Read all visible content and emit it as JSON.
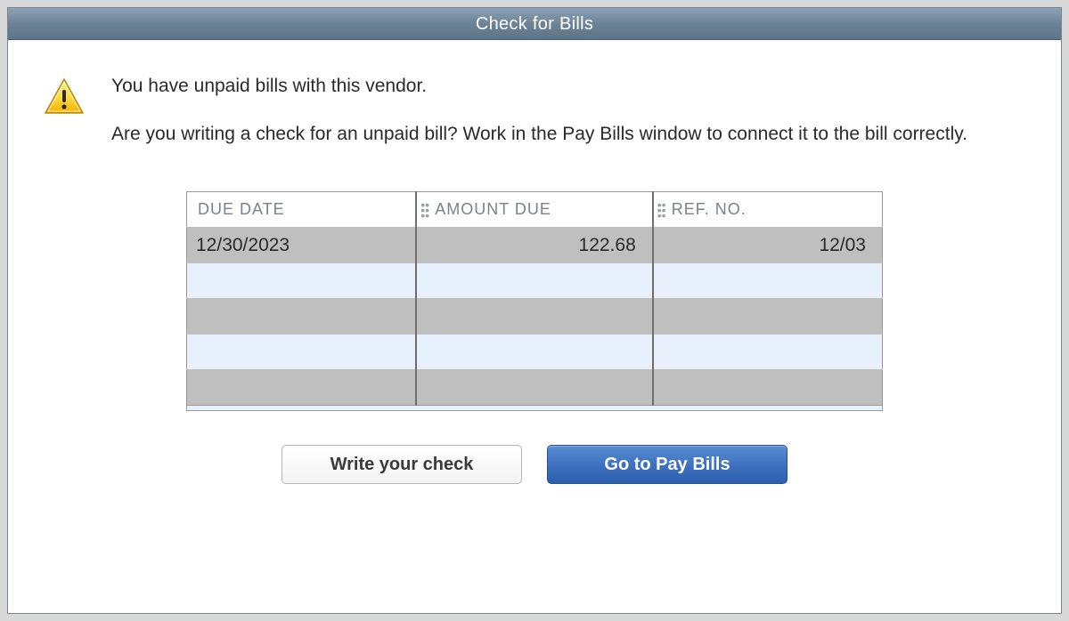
{
  "window": {
    "title": "Check for Bills"
  },
  "message": {
    "line1": "You have unpaid bills with this vendor.",
    "line2": "Are you writing a check for an unpaid bill? Work in the Pay Bills window to connect it to the bill correctly."
  },
  "table": {
    "headers": {
      "due_date": "DUE DATE",
      "amount_due": "AMOUNT DUE",
      "ref_no": "REF. NO."
    },
    "rows": [
      {
        "due_date": "12/30/2023",
        "amount_due": "122.68",
        "ref_no": "12/03"
      }
    ]
  },
  "buttons": {
    "write_check": "Write your check",
    "go_to_pay_bills": "Go to Pay Bills"
  },
  "icons": {
    "warning": "warning-triangle"
  }
}
